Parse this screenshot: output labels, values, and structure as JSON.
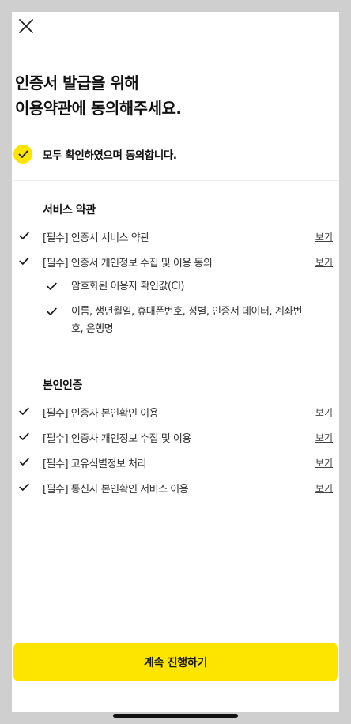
{
  "header": {
    "title_line1": "인증서 발급을 위해",
    "title_line2": "이용약관에 동의해주세요."
  },
  "agree_all": {
    "label": "모두 확인하였으며 동의합니다.",
    "checked": true,
    "color": "#fee500"
  },
  "service_terms": {
    "title": "서비스 약관",
    "items": [
      {
        "label": "[필수] 인증서 서비스 약관",
        "view": "보기",
        "checked": true
      },
      {
        "label": "[필수] 인증서 개인정보 수집 및 이용 동의",
        "view": "보기",
        "checked": true
      }
    ],
    "sub_items": [
      {
        "label": "암호화된 이용자 확인값(CI)",
        "checked": true
      },
      {
        "label": "이름, 생년월일, 휴대폰번호, 성별, 인증서 데이터, 계좌번호, 은행명",
        "checked": true
      }
    ]
  },
  "identity_terms": {
    "title": "본인인증",
    "items": [
      {
        "label": "[필수] 인증사 본인확인 이용",
        "view": "보기",
        "checked": true
      },
      {
        "label": "[필수] 인증사 개인정보 수집 및 이용",
        "view": "보기",
        "checked": true
      },
      {
        "label": "[필수] 고유식별정보 처리",
        "view": "보기",
        "checked": true
      },
      {
        "label": "[필수] 통신사 본인확인 서비스 이용",
        "view": "보기",
        "checked": true
      }
    ]
  },
  "footer": {
    "continue_label": "계속 진행하기",
    "button_color": "#fee500"
  }
}
